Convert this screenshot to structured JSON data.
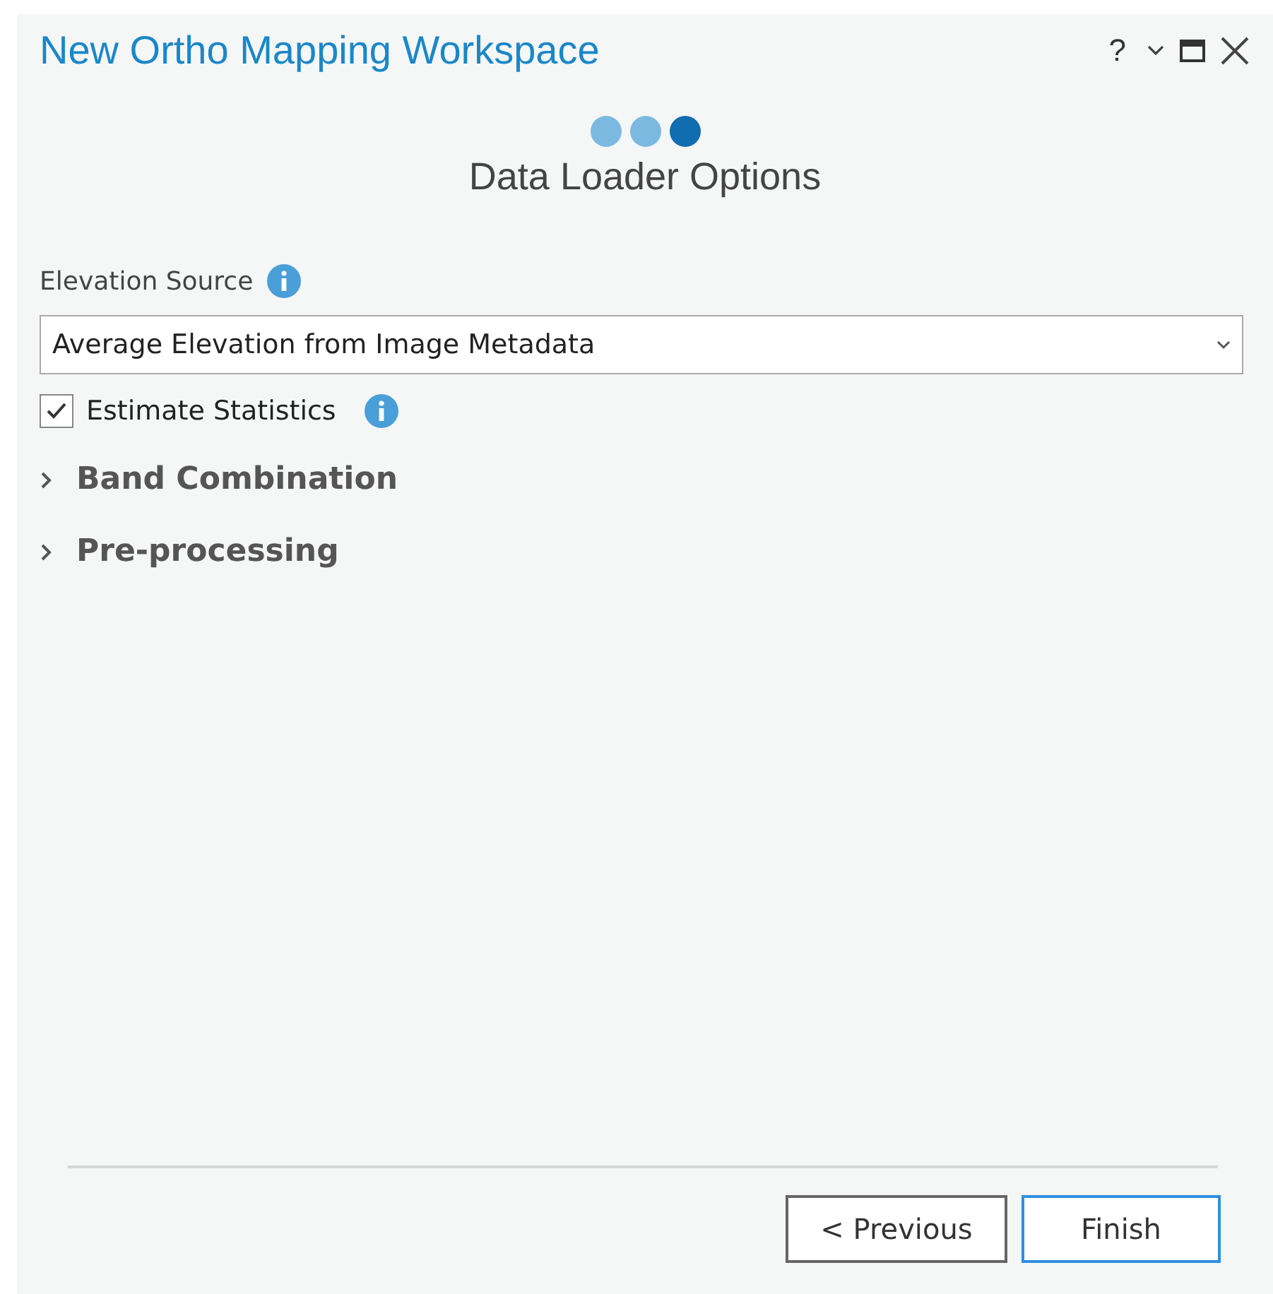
{
  "window": {
    "title": "New Ortho Mapping Workspace",
    "help": "?"
  },
  "steps": [
    {
      "selected": false
    },
    {
      "selected": false
    },
    {
      "selected": true
    }
  ],
  "page_title": "Data Loader Options",
  "elevation": {
    "label": "Elevation Source",
    "value": "Average Elevation from Image Metadata"
  },
  "estimate": {
    "label": "Estimate Statistics",
    "checked": true
  },
  "sections": [
    {
      "label": "Band Combination",
      "expanded": false
    },
    {
      "label": "Pre-processing",
      "expanded": false
    }
  ],
  "buttons": [
    {
      "label": "< Previous",
      "kind": "secondary"
    },
    {
      "label": "Finish",
      "kind": "primary"
    }
  ]
}
